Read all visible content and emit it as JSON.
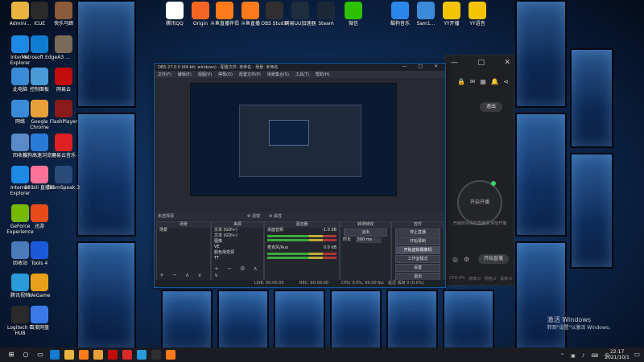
{
  "desktop": {
    "icons_top": [
      {
        "label": "Admini...",
        "icon": "user-folder-icon",
        "color": "#e8b341"
      },
      {
        "label": "iCUE",
        "icon": "icue-icon",
        "color": "#2a2a2a"
      },
      {
        "label": "快乐马蹄",
        "icon": "photo-icon",
        "color": "#8a5a3a"
      },
      {
        "label": "腾讯QQ",
        "icon": "qq-icon",
        "color": "#ffffff"
      },
      {
        "label": "Origin",
        "icon": "origin-icon",
        "color": "#f26522"
      },
      {
        "label": "斗鱼直播伴侣",
        "icon": "douyu-icon",
        "color": "#ff7a1a"
      },
      {
        "label": "斗鱼直播",
        "icon": "douyu-live-icon",
        "color": "#ff7a1a"
      },
      {
        "label": "OBS Studio",
        "icon": "obs-icon",
        "color": "#302e31"
      },
      {
        "label": "网易UU加速器",
        "icon": "uu-icon",
        "color": "#1d2d3d"
      },
      {
        "label": "Steam",
        "icon": "steam-icon",
        "color": "#1b2838"
      },
      {
        "label": "微信",
        "icon": "wechat-icon",
        "color": "#2dc100"
      },
      {
        "label": "酷狗音乐",
        "icon": "kugou-icon",
        "color": "#2a86e8"
      },
      {
        "label": "Sam1...",
        "icon": "sam-icon",
        "color": "#3a8ad8"
      },
      {
        "label": "YY开播",
        "icon": "yy-icon",
        "color": "#f5c400"
      },
      {
        "label": "YY语音",
        "icon": "yy-voice-icon",
        "color": "#f5c400"
      }
    ],
    "icons_left": [
      {
        "label": "Internet Explorer",
        "icon": "ie-icon",
        "color": "#1e88e5"
      },
      {
        "label": "Microsoft Edge",
        "icon": "edge-icon",
        "color": "#0f7bd1"
      },
      {
        "label": "A3 ...",
        "icon": "app-icon",
        "color": "#7a6a5a"
      },
      {
        "label": "此电脑",
        "icon": "computer-icon",
        "color": "#3a8ad8"
      },
      {
        "label": "控制面板",
        "icon": "control-panel-icon",
        "color": "#4a9ad8"
      },
      {
        "label": "网易云",
        "icon": "netease-icon",
        "color": "#c20c0c"
      },
      {
        "label": "网络",
        "icon": "network-icon",
        "color": "#3a8ad8"
      },
      {
        "label": "Google Chrome",
        "icon": "chrome-icon",
        "color": "#e8a13a"
      },
      {
        "label": "FlashPlayer",
        "icon": "flash-icon",
        "color": "#8a1a1a"
      },
      {
        "label": "回收站",
        "icon": "recycle-bin-icon",
        "color": "#5a8ac8"
      },
      {
        "label": "搜狗高速浏览器",
        "icon": "sogou-icon",
        "color": "#2a7ad8"
      },
      {
        "label": "网易云音乐",
        "icon": "music-icon",
        "color": "#e02020"
      },
      {
        "label": "Internet Explorer",
        "icon": "ie2-icon",
        "color": "#1e88e5"
      },
      {
        "label": "Bilibili 直播姬",
        "icon": "bilibili-icon",
        "color": "#fb7299"
      },
      {
        "label": "TeamSpeak 3",
        "icon": "teamspeak-icon",
        "color": "#2a4a7a"
      },
      {
        "label": "GeForce Experience",
        "icon": "geforce-icon",
        "color": "#76b900"
      },
      {
        "label": "迅游",
        "icon": "xunyou-icon",
        "color": "#e84a1a"
      },
      {
        "label": "回收站",
        "icon": "trash-icon",
        "color": "#4a7ab8"
      },
      {
        "label": "Tools 4",
        "icon": "tools-icon",
        "color": "#1a5ad8"
      },
      {
        "label": "腾讯视频",
        "icon": "tencent-video-icon",
        "color": "#2a9ad8"
      },
      {
        "label": "WeGame",
        "icon": "wegame-icon",
        "color": "#e8a01a"
      },
      {
        "label": "Logitech G HUB",
        "icon": "ghub-icon",
        "color": "#2a2a2a"
      },
      {
        "label": "百度网盘",
        "icon": "baidu-disk-icon",
        "color": "#3a7ae8"
      }
    ]
  },
  "side_app": {
    "exit_label": "退出",
    "circle_label": "开启开播",
    "hint": "开播前请添加直播源 添加开播",
    "live_label": "开始直播",
    "stats": [
      "CPU:0%",
      "帧率:0",
      "网络:0",
      "丢帧:0"
    ]
  },
  "obs": {
    "title": "OBS 27.0.0 (64-bit, windows) - 配置文件: 未命名 - 场景: 未命名",
    "menu": [
      "文件(F)",
      "编辑(E)",
      "视图(V)",
      "停靠(D)",
      "配置文件(P)",
      "场景集合(S)",
      "工具(T)",
      "帮助(H)"
    ],
    "no_source": "未选择源",
    "filters_label": "滤镜",
    "props_label": "属性",
    "docks": {
      "scenes": {
        "title": "场景",
        "items": [
          "场景"
        ]
      },
      "sources": {
        "title": "来源",
        "items": [
          "文本 (GDI+)",
          "文本 (GDI+)",
          "图像",
          "VE",
          "颜色渐变源",
          "TT"
        ]
      },
      "mixer": {
        "title": "混音器",
        "items": [
          "桌面音频",
          "麦克风/Aux"
        ],
        "values": [
          "-1.0 dB",
          "0.0 dB"
        ]
      },
      "transitions": {
        "title": "转场特效",
        "fade": "淡出",
        "duration_label": "时长",
        "duration": "300 ms"
      },
      "controls": {
        "title": "控件",
        "buttons": [
          "停止直播",
          "开始录制",
          "开始虚拟摄像机",
          "工作室模式",
          "设置",
          "退出"
        ]
      }
    },
    "status": {
      "live": "LIVE: 00:00:00",
      "rec": "REC: 00:00:00",
      "cpu": "CPU: 0.5%, 60.00 fps",
      "drop": "延迟 丢帧 0 (0.0%)"
    }
  },
  "watermark": {
    "line1": "激活 Windows",
    "line2": "转到\"设置\"以激活 Windows。"
  },
  "taskbar": {
    "time": "22:17",
    "date": "2021/10/1",
    "apps": [
      {
        "icon": "start-icon",
        "color": "#1a1c22"
      },
      {
        "icon": "search-icon",
        "color": "#1a1c22"
      },
      {
        "icon": "task-view-icon",
        "color": "#1a1c22"
      },
      {
        "icon": "edge-icon",
        "color": "#0f7bd1"
      },
      {
        "icon": "folder-icon",
        "color": "#e8b341"
      },
      {
        "icon": "douyu-icon",
        "color": "#ff7a1a"
      },
      {
        "icon": "chrome-icon",
        "color": "#e8a13a"
      },
      {
        "icon": "netease-icon",
        "color": "#c20c0c"
      },
      {
        "icon": "app-icon",
        "color": "#d82a2a"
      },
      {
        "icon": "qq-icon",
        "color": "#2a9ad8"
      },
      {
        "icon": "obs-icon",
        "color": "#302e31"
      },
      {
        "icon": "douyu-live-icon",
        "color": "#ff7a1a"
      }
    ]
  }
}
